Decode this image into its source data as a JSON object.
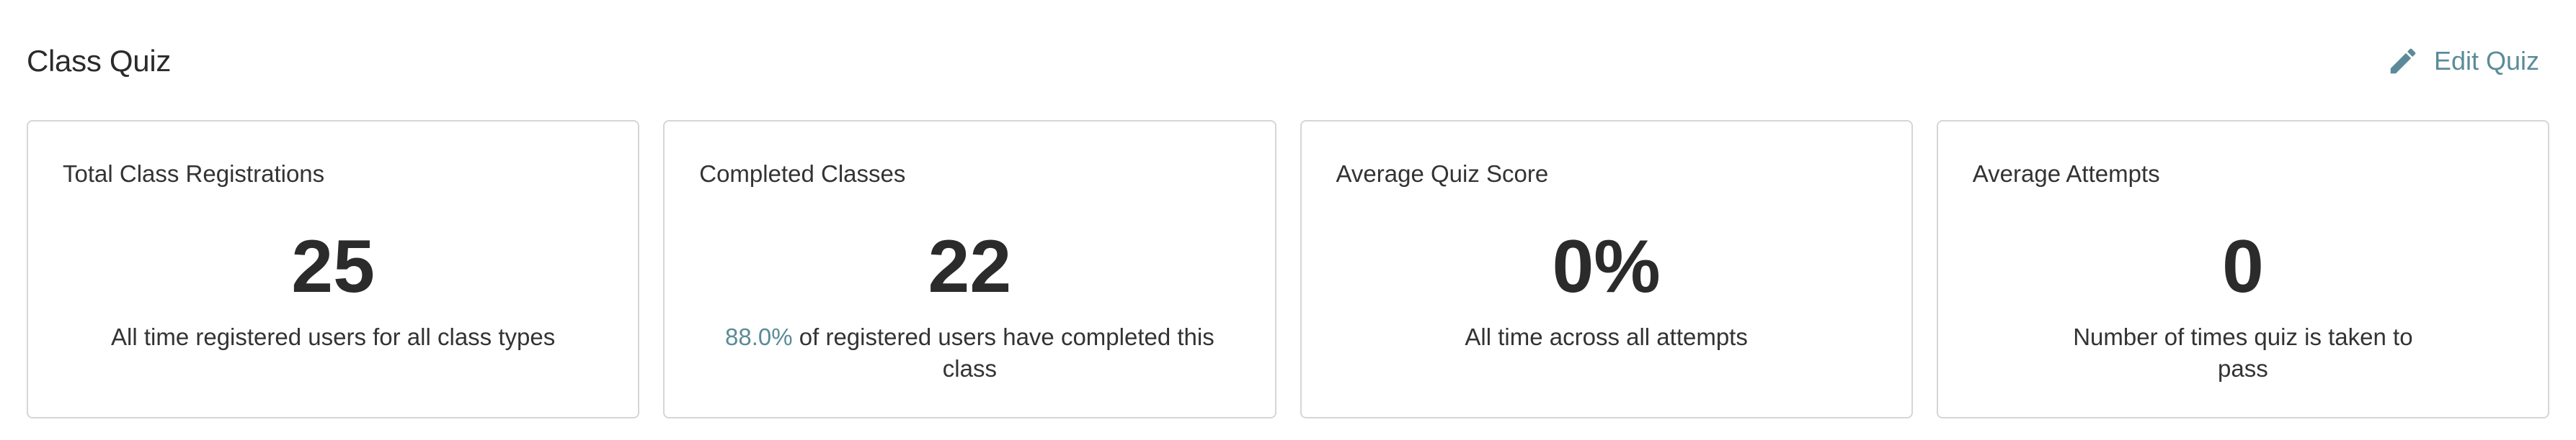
{
  "header": {
    "title": "Class Quiz",
    "edit_label": "Edit Quiz",
    "edit_icon": "pencil-icon",
    "accent_color": "#5b8b98"
  },
  "cards": [
    {
      "title": "Total Class Registrations",
      "value": "25",
      "description": "All time registered users for all class types"
    },
    {
      "title": "Completed Classes",
      "value": "22",
      "description_highlight": "88.0%",
      "description": " of registered users have completed this class"
    },
    {
      "title": "Average Quiz Score",
      "value": "0%",
      "description": "All time across all attempts"
    },
    {
      "title": "Average Attempts",
      "value": "0",
      "description": "Number of times quiz is taken to pass"
    }
  ]
}
